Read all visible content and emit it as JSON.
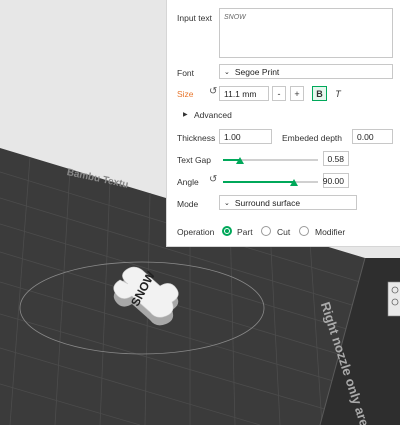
{
  "panel": {
    "input_text_label": "Input text",
    "input_text_value": "SNOW",
    "font_label": "Font",
    "font_value": "Segoe Print",
    "size_label": "Size",
    "size_value": "11.1 mm",
    "minus_label": "-",
    "plus_label": "+",
    "bold_label": "B",
    "italic_label": "T",
    "advanced_label": "Advanced",
    "thickness_label": "Thickness",
    "thickness_value": "1.00",
    "embedded_depth_label": "Embeded depth",
    "embedded_depth_value": "0.00",
    "text_gap_label": "Text Gap",
    "text_gap_value": "0.58",
    "text_gap_fraction": 0.18,
    "angle_label": "Angle",
    "angle_value": "90.00",
    "angle_fraction": 0.75,
    "mode_label": "Mode",
    "mode_value": "Surround surface",
    "operation_label": "Operation",
    "operations": [
      "Part",
      "Cut",
      "Modifier"
    ],
    "selected_operation": "Part"
  },
  "viewport": {
    "bed_brand": "Bambu Textu",
    "nozzle_warning": "Right nozzle only area",
    "object_text": "SNOW"
  },
  "colors": {
    "accent": "#00a85a",
    "size_label": "#e8772e",
    "bed": "#3a3a3a",
    "grid": "#4a4a4a"
  }
}
